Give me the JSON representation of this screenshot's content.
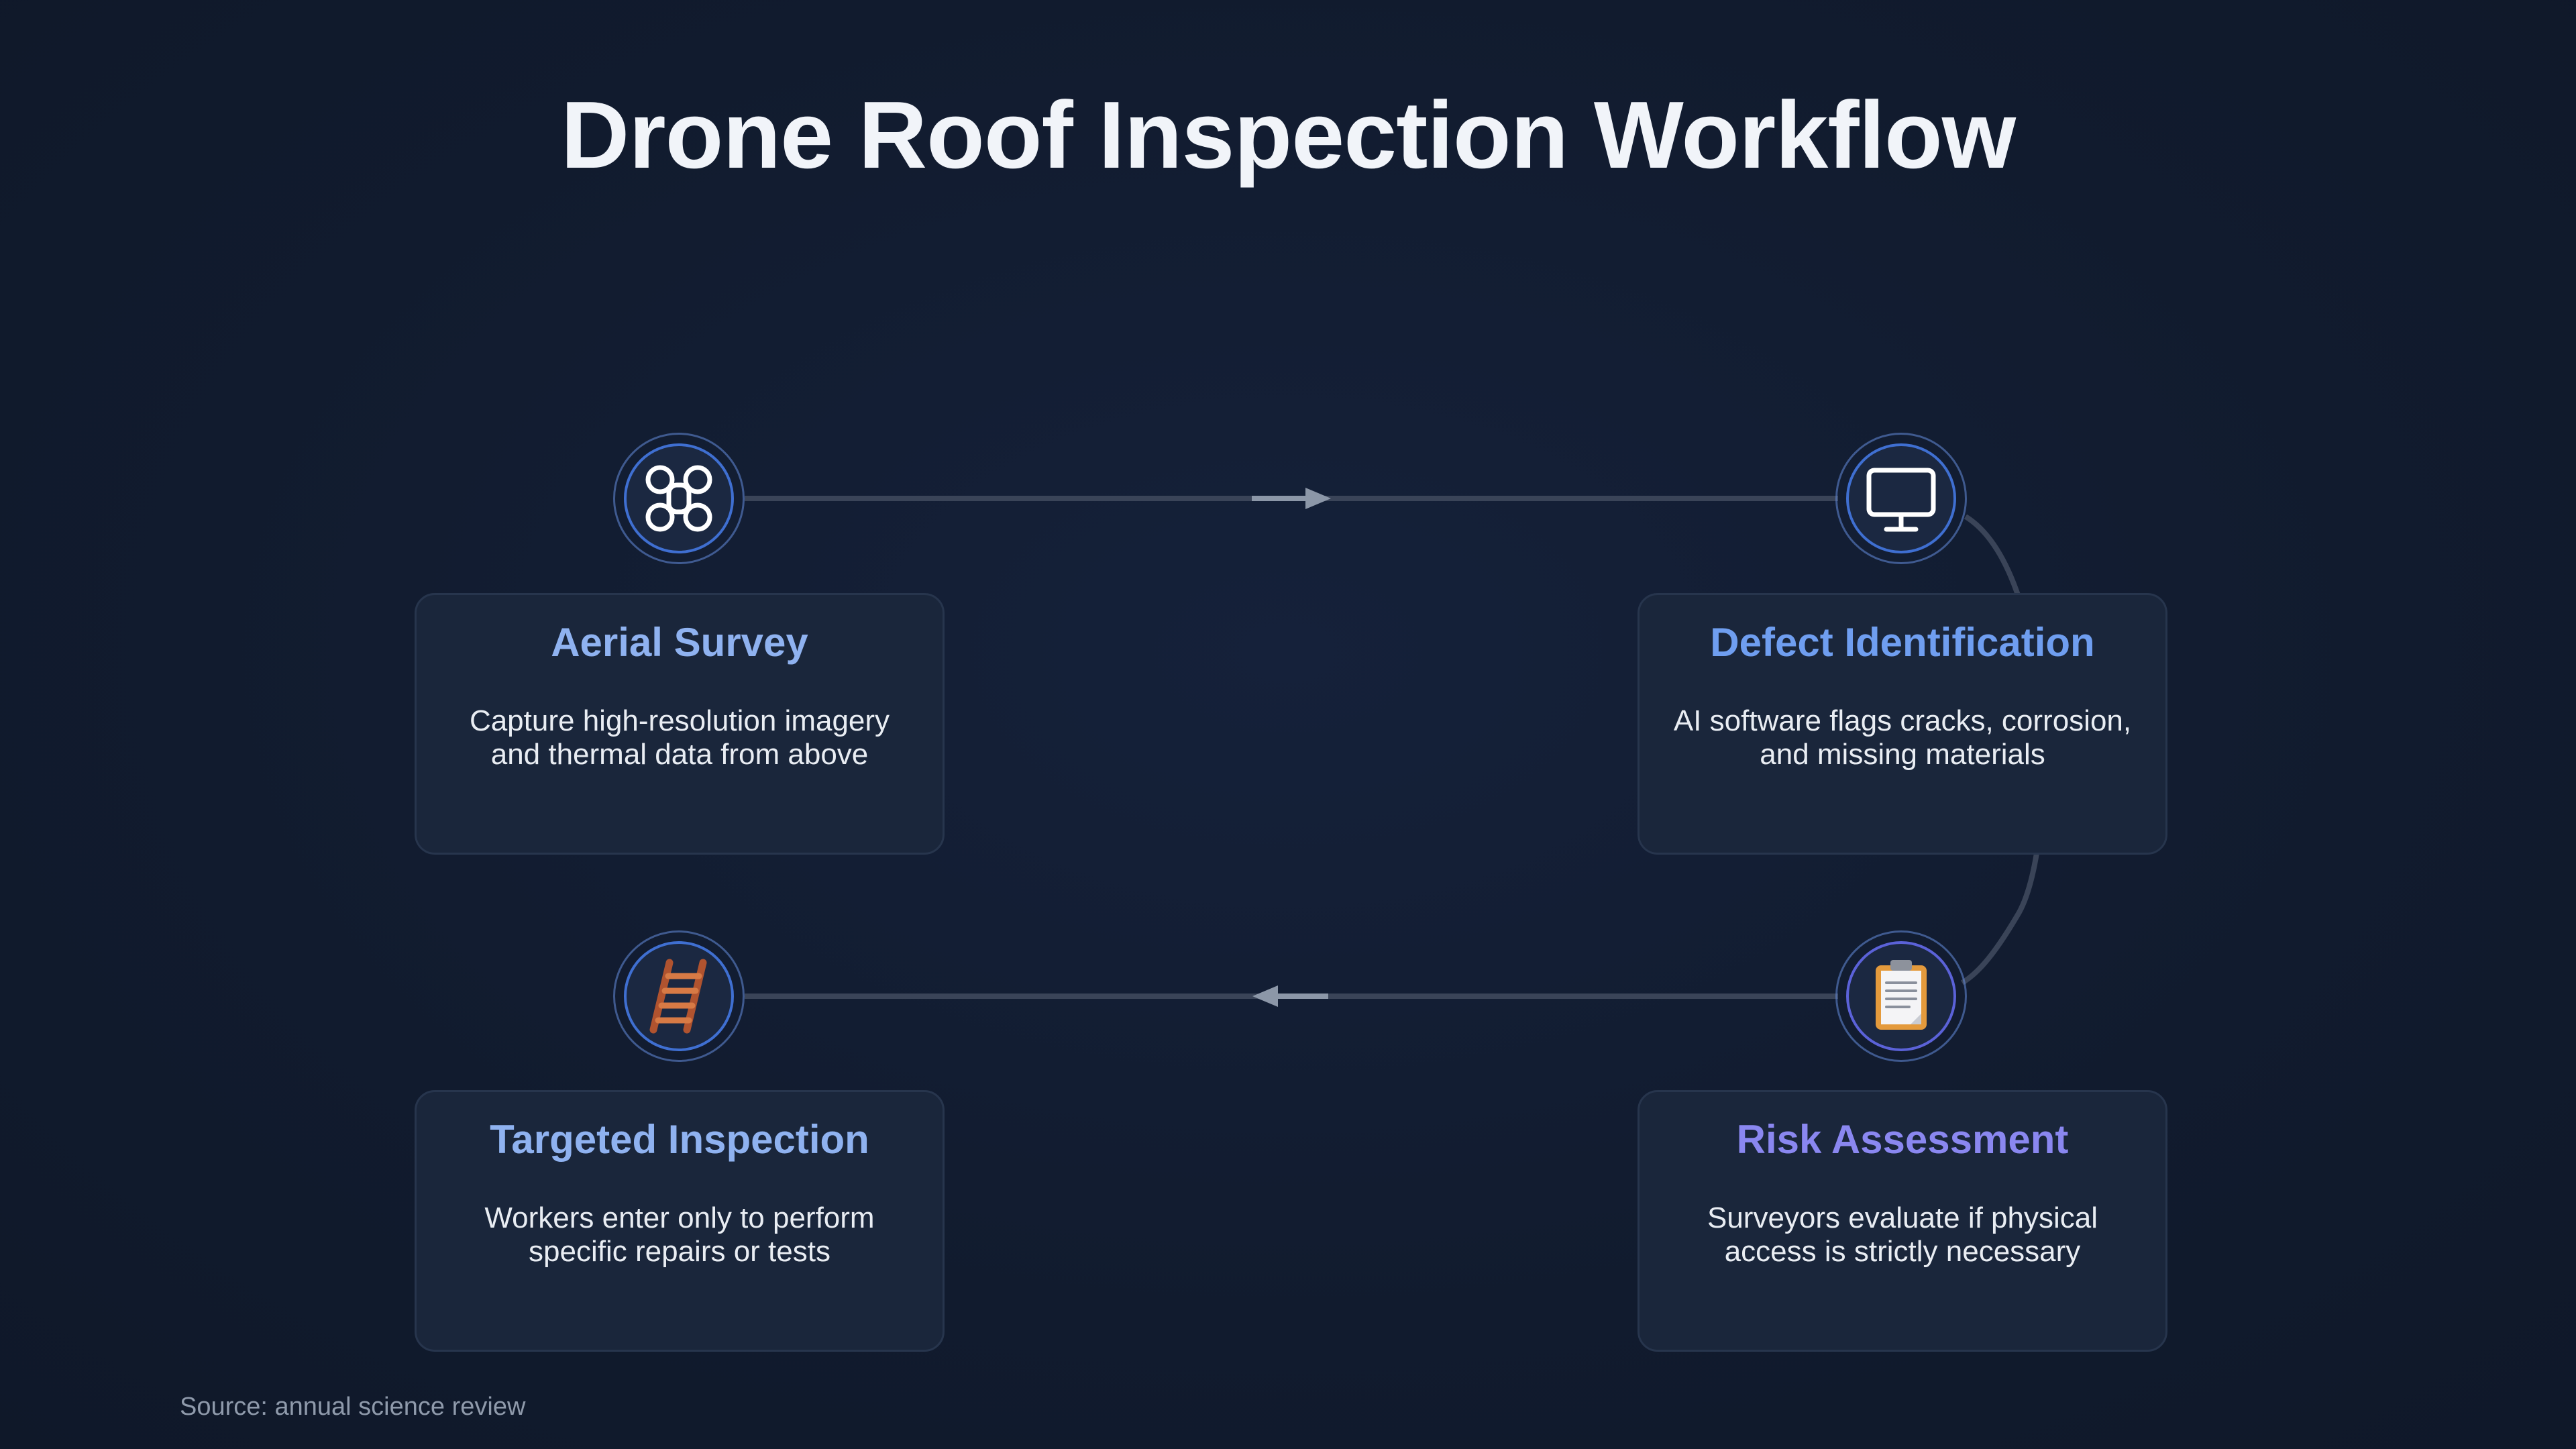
{
  "title": "Drone Roof Inspection Workflow",
  "steps": [
    {
      "title": "Aerial Survey",
      "description": "Capture high-resolution imagery and thermal data from above",
      "icon": "drone-icon",
      "accent": "#8fb2f0"
    },
    {
      "title": "Defect Identification",
      "description": "AI software flags cracks, corrosion, and missing materials",
      "icon": "monitor-icon",
      "accent": "#6f9ef0"
    },
    {
      "title": "Risk Assessment",
      "description": "Surveyors evaluate if physical access is strictly necessary",
      "icon": "clipboard-icon",
      "accent": "#8a87f0"
    },
    {
      "title": "Targeted Inspection",
      "description": "Workers enter only to perform specific repairs or tests",
      "icon": "ladder-icon",
      "accent": "#8fb2f0"
    }
  ],
  "source": "Source: annual science review"
}
